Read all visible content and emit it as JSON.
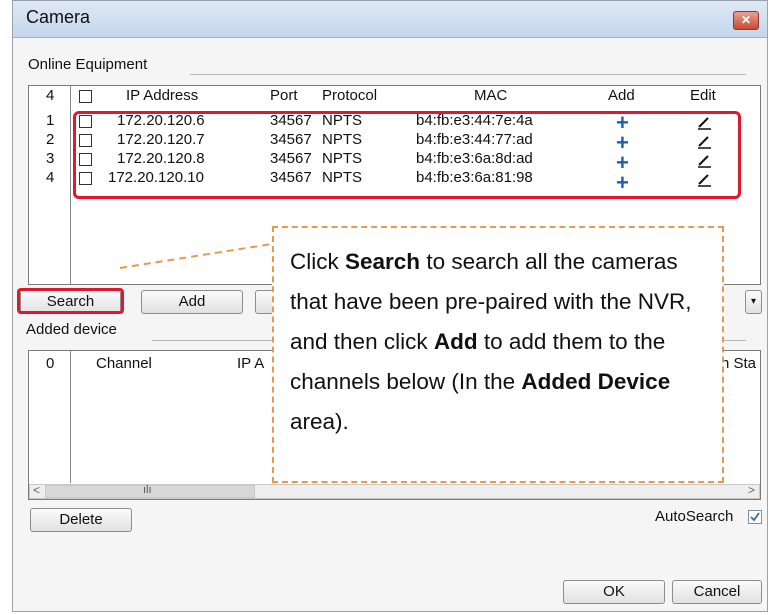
{
  "window": {
    "title": "Camera",
    "close_icon": "close-icon"
  },
  "online": {
    "group_label": "Online Equipment",
    "count": "4",
    "headers": {
      "ip": "IP Address",
      "port": "Port",
      "protocol": "Protocol",
      "mac": "MAC",
      "add": "Add",
      "edit": "Edit"
    },
    "rows": [
      {
        "no": "1",
        "ip": "172.20.120.6",
        "port": "34567",
        "protocol": "NPTS",
        "mac": "b4:fb:e3:44:7e:4a"
      },
      {
        "no": "2",
        "ip": "172.20.120.7",
        "port": "34567",
        "protocol": "NPTS",
        "mac": "b4:fb:e3:44:77:ad"
      },
      {
        "no": "3",
        "ip": "172.20.120.8",
        "port": "34567",
        "protocol": "NPTS",
        "mac": "b4:fb:e3:6a:8d:ad"
      },
      {
        "no": "4",
        "ip": "172.20.120.10",
        "port": "34567",
        "protocol": "NPTS",
        "mac": "b4:fb:e3:6a:81:98"
      }
    ]
  },
  "buttons": {
    "search": "Search",
    "add": "Add",
    "delete": "Delete",
    "ok": "OK",
    "cancel": "Cancel"
  },
  "added": {
    "group_label": "Added device",
    "count": "0",
    "headers": {
      "channel": "Channel",
      "ip_partial": "IP A",
      "status_partial": "n Sta"
    }
  },
  "scrollbar": {
    "left": "<",
    "right": ">",
    "thumb_grip": "ılı"
  },
  "autosearch": {
    "label": "AutoSearch",
    "checked": true
  },
  "callout": {
    "t1": "Click ",
    "b1": "Search",
    "t2": " to search all the cameras that have been pre-paired with the NVR, and then click ",
    "b2": "Add",
    "t3": " to add them to the channels below (In the ",
    "b3": "Added Device",
    "t4": " area)."
  }
}
